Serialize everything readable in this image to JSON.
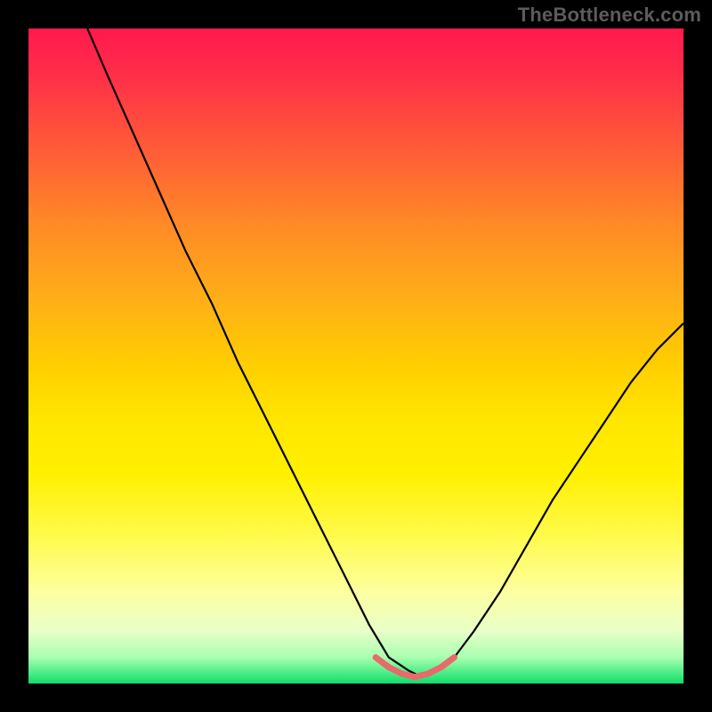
{
  "watermark": {
    "text": "TheBottleneck.com"
  },
  "colors": {
    "frame": "#000000",
    "curve": "#000000",
    "accent": "#e86a6a"
  },
  "chart_data": {
    "type": "line",
    "title": "",
    "xlabel": "",
    "ylabel": "",
    "xlim": [
      0,
      100
    ],
    "ylim": [
      0,
      100
    ],
    "grid": false,
    "legend": false,
    "note": "V-shaped bottleneck curve on rainbow gradient; minimum plateau near x≈55–65 at y≈1–2; curve hits y=100 at x≈9 on the left and y≈55 at x=100 on the right. Short pink segment highlights the flat trough.",
    "series": [
      {
        "name": "bottleneck-curve",
        "color": "#000000",
        "x": [
          9,
          12,
          16,
          20,
          24,
          28,
          32,
          36,
          40,
          44,
          48,
          52,
          55,
          58,
          60,
          62,
          65,
          68,
          72,
          76,
          80,
          84,
          88,
          92,
          96,
          100
        ],
        "y": [
          100,
          93,
          84,
          75,
          66,
          58,
          49,
          41,
          33,
          25,
          17,
          9,
          4,
          2,
          1,
          2,
          4,
          8,
          14,
          21,
          28,
          34,
          40,
          46,
          51,
          55
        ]
      },
      {
        "name": "trough-highlight",
        "color": "#e86a6a",
        "x": [
          53,
          55,
          57,
          59,
          61,
          63,
          65
        ],
        "y": [
          4,
          2.5,
          1.5,
          1,
          1.5,
          2.5,
          4
        ]
      }
    ]
  }
}
